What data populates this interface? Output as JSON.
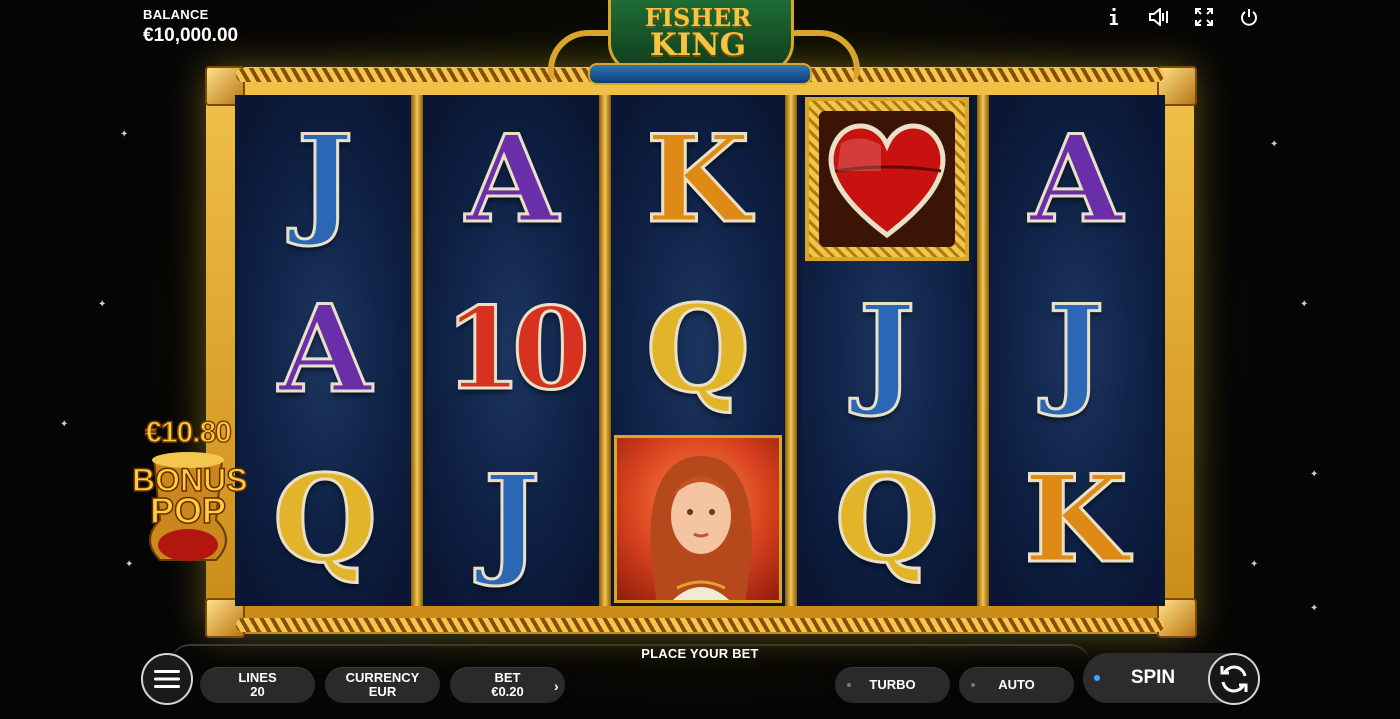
{
  "balance": {
    "label": "BALANCE",
    "value": "€10,000.00"
  },
  "logo": {
    "line1": "FISHER",
    "line2": "KING"
  },
  "top_icons": [
    "info-icon",
    "sound-icon",
    "fullscreen-icon",
    "power-icon"
  ],
  "reels": [
    [
      "J",
      "A",
      "Q"
    ],
    [
      "A",
      "10",
      "J"
    ],
    [
      "K",
      "Q",
      "princess"
    ],
    [
      "heart",
      "J",
      "Q"
    ],
    [
      "A",
      "J",
      "K"
    ]
  ],
  "symbol_colors": {
    "J": "#2c67b5",
    "A": "#6a2ea8",
    "K": "#e08a16",
    "Q": "#e2b42a",
    "10": "#d7321f"
  },
  "bonus": {
    "amount": "€10.80",
    "word1": "BONUS",
    "word2": "POP"
  },
  "controls": {
    "place_bet": "PLACE YOUR BET",
    "lines_label": "LINES",
    "lines_value": "20",
    "currency_label": "CURRENCY",
    "currency_value": "EUR",
    "bet_label": "BET",
    "bet_value": "€0.20",
    "turbo": "TURBO",
    "auto": "AUTO",
    "spin": "SPIN"
  }
}
